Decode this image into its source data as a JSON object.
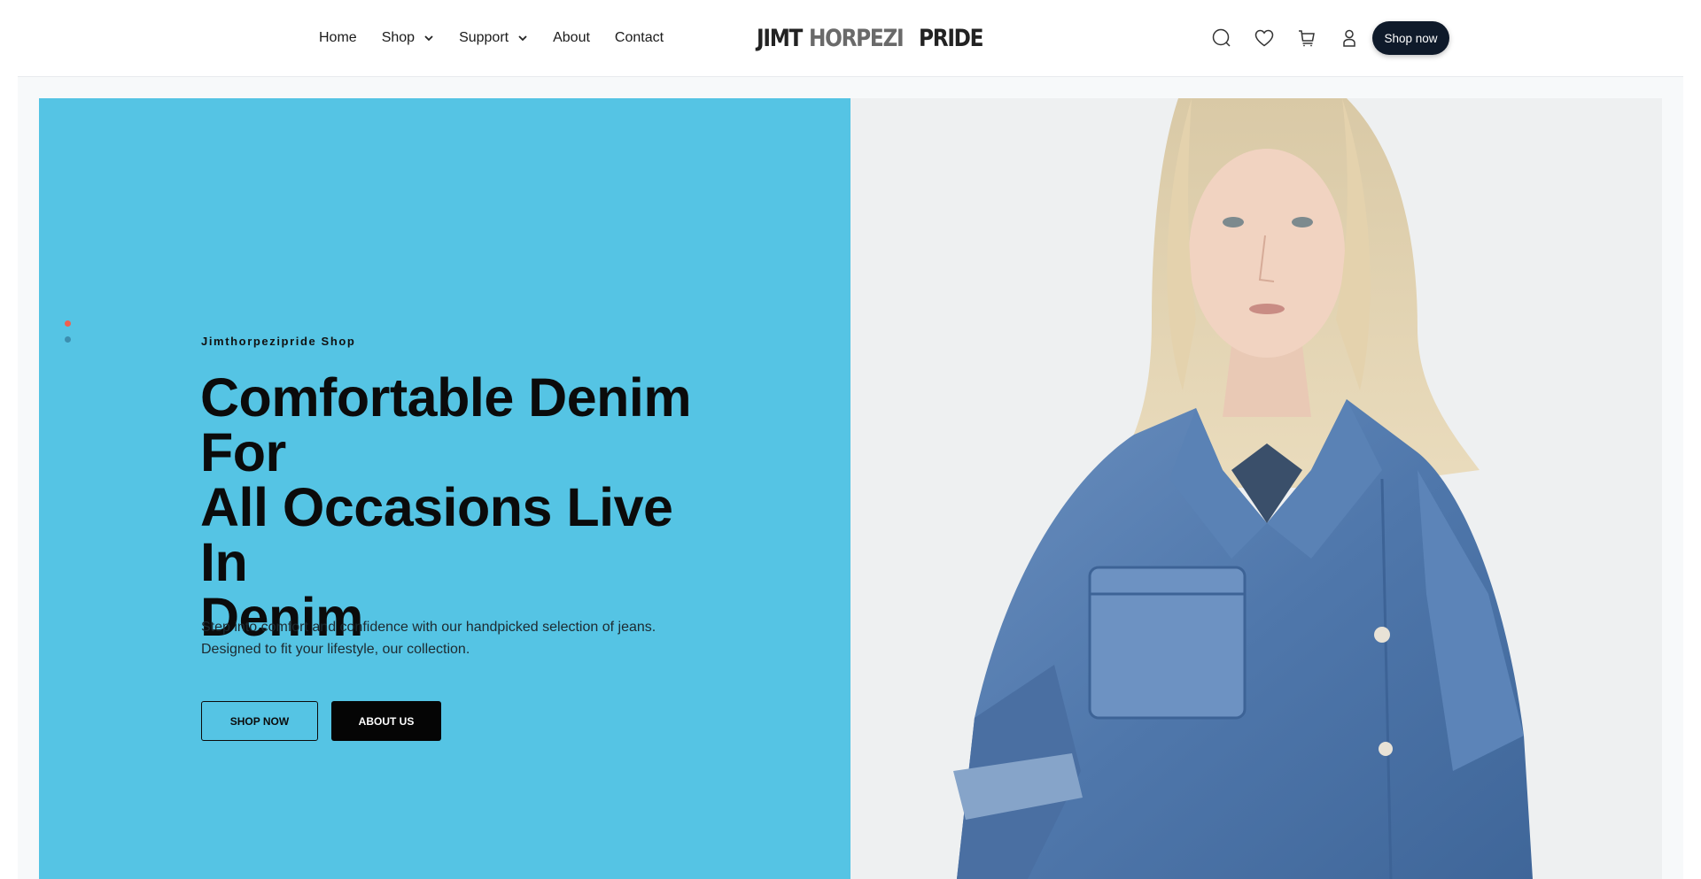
{
  "nav": {
    "items": [
      {
        "label": "Home",
        "dropdown": false
      },
      {
        "label": "Shop",
        "dropdown": true
      },
      {
        "label": "Support",
        "dropdown": true
      },
      {
        "label": "About",
        "dropdown": false
      },
      {
        "label": "Contact",
        "dropdown": false
      }
    ]
  },
  "brand": {
    "logo_text": "JIMTHORPEZIPRIDE",
    "logo_parts": [
      "JIMT",
      "HORPEZI",
      "PRIDE"
    ]
  },
  "header_actions": {
    "icons": [
      "search-icon",
      "heart-icon",
      "cart-icon",
      "user-icon"
    ],
    "cta_label": "Shop now"
  },
  "hero": {
    "eyebrow": "Jimthorpezipride Shop",
    "headline_lines": [
      "Comfortable Denim",
      "For",
      "All Occasions Live In",
      "Denim"
    ],
    "description_lines": [
      "Step into comfort and confidence with our handpicked selection of jeans.",
      "Designed to fit your lifestyle, our collection."
    ],
    "primary_button": "SHOP NOW",
    "secondary_button": "ABOUT US",
    "slides": 2,
    "active_slide": 1
  },
  "colors": {
    "hero_bg": "#55c4e4",
    "photo_bg": "#eef0f1",
    "dot_active": "#f0604f",
    "dot_idle": "#3c8fb0",
    "pill_bg": "#0f1a2a",
    "button_dark": "#050505"
  }
}
